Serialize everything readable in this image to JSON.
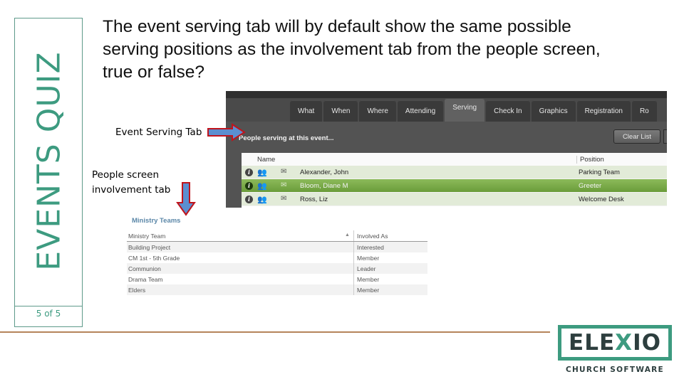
{
  "sidebar": {
    "title": "EVENTS QUIZ",
    "page_indicator": "5 of 5"
  },
  "question": "The event serving tab will by default show the same possible serving positions as the involvement tab from the people screen, true or false?",
  "annotations": {
    "serving_label": "Event Serving Tab",
    "people_label_line1": "People screen",
    "people_label_line2": "involvement tab"
  },
  "serving_screen": {
    "tabs": [
      {
        "label": "What",
        "active": false
      },
      {
        "label": "When",
        "active": false
      },
      {
        "label": "Where",
        "active": false
      },
      {
        "label": "Attending",
        "active": false
      },
      {
        "label": "Serving",
        "active": true
      },
      {
        "label": "Check In",
        "active": false
      },
      {
        "label": "Graphics",
        "active": false
      },
      {
        "label": "Registration",
        "active": false
      },
      {
        "label": "Ro",
        "active": false
      }
    ],
    "heading": "People serving at this event...",
    "clear_button": "Clear List",
    "columns": {
      "name": "Name",
      "position": "Position"
    },
    "rows": [
      {
        "name": "Alexander, John",
        "position": "Parking Team",
        "selected": false
      },
      {
        "name": "Bloom, Diane M",
        "position": "Greeter",
        "selected": true
      },
      {
        "name": "Ross, Liz",
        "position": "Welcome Desk",
        "selected": false
      }
    ],
    "icons": {
      "info": "info-icon",
      "people": "people-icon",
      "mail": "mail-icon"
    }
  },
  "ministry_teams": {
    "title": "Ministry Teams",
    "columns": {
      "team": "Ministry Team",
      "involved": "Involved As"
    },
    "rows": [
      {
        "team": "Building Project",
        "involved": "Interested"
      },
      {
        "team": "CM 1st - 5th Grade",
        "involved": "Member"
      },
      {
        "team": "Communion",
        "involved": "Leader"
      },
      {
        "team": "Drama Team",
        "involved": "Member"
      },
      {
        "team": "Elders",
        "involved": "Member"
      }
    ]
  },
  "logo": {
    "pre": "ELE",
    "x": "X",
    "post": "IO",
    "subtitle": "CHURCH SOFTWARE"
  },
  "colors": {
    "brand_green": "#3d9b80",
    "selected_row": "#7aac48",
    "arrow_fill": "#5b8fd0",
    "arrow_stroke": "#c0141c",
    "rule": "#b5845a"
  }
}
